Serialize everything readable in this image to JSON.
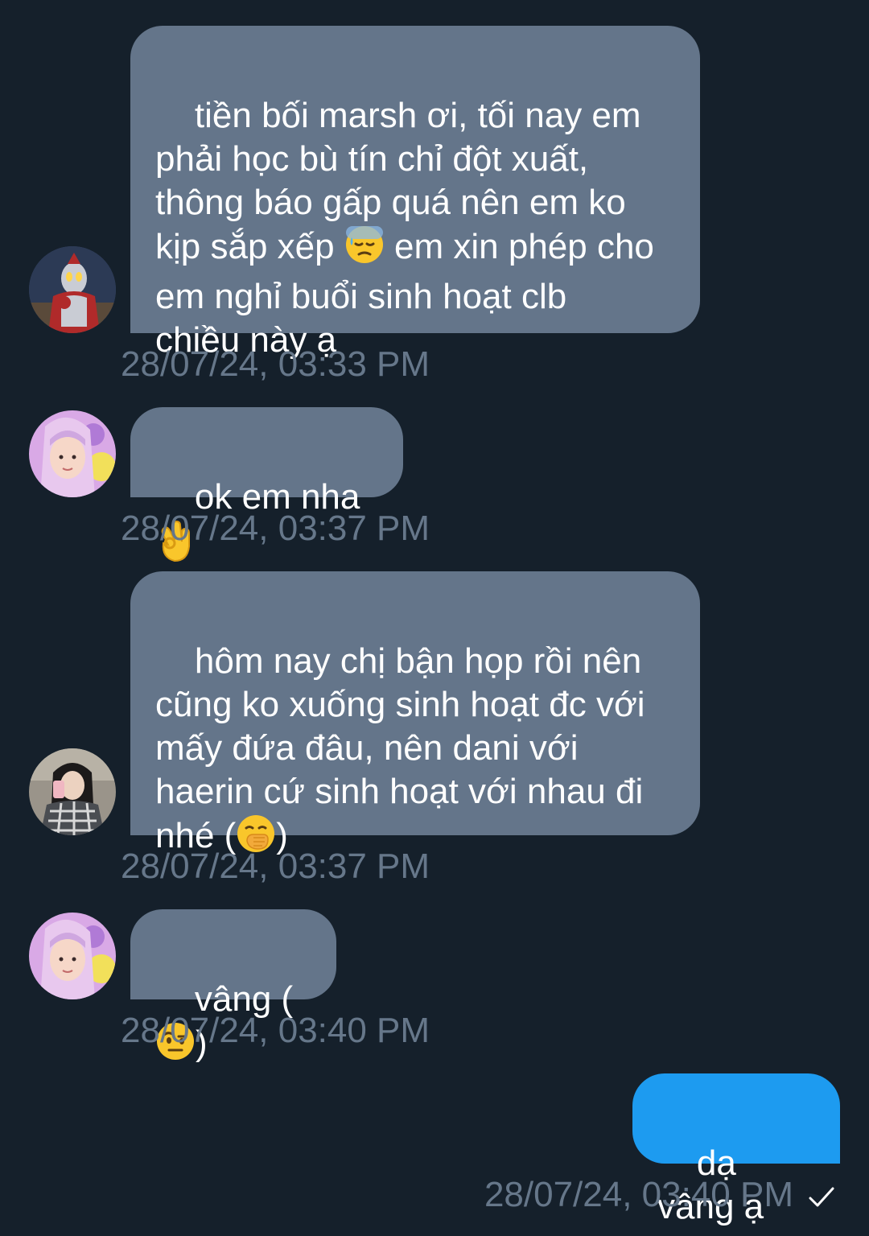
{
  "messages": [
    {
      "sender": "other",
      "avatar": "ultraman-avatar",
      "text_parts": [
        "tiền bối marsh ơi, tối nay em\nphải học bù tín chỉ đột xuất,\nthông báo gấp quá nên em ko\nkịp sắp xếp ",
        " em xin phép cho\nem nghỉ buổi sinh hoạt clb\nchiều này ạ"
      ],
      "emoji": "downcast-sweat-emoji",
      "timestamp": "28/07/24, 03:33 PM"
    },
    {
      "sender": "other",
      "avatar": "girl-pink-hair-avatar",
      "text_parts": [
        "ok em nha ",
        ""
      ],
      "emoji": "ok-hand-emoji",
      "timestamp": "28/07/24, 03:37 PM"
    },
    {
      "sender": "other",
      "avatar": "girl-mirror-selfie-avatar",
      "text_parts": [
        "hôm nay chị bận họp rồi nên\ncũng ko xuống sinh hoạt đc với\nmấy đứa đâu, nên dani với\nhaerin cứ sinh hoạt với nhau đi\nnhé (",
        ")"
      ],
      "emoji": "hand-over-mouth-emoji",
      "timestamp": "28/07/24, 03:37 PM"
    },
    {
      "sender": "other",
      "avatar": "girl-pink-hair-avatar",
      "text_parts": [
        "vâng (",
        ")"
      ],
      "emoji": "raised-eyebrow-emoji",
      "timestamp": "28/07/24, 03:40 PM"
    },
    {
      "sender": "me",
      "text_parts": [
        "dạ vâng ạ"
      ],
      "timestamp": "28/07/24, 03:40 PM",
      "read_receipt": "checkmark-icon"
    }
  ],
  "colors": {
    "background": "#15202b",
    "incoming_bubble": "#64758a",
    "outgoing_bubble": "#1d9bf0",
    "timestamp": "#66778a"
  }
}
